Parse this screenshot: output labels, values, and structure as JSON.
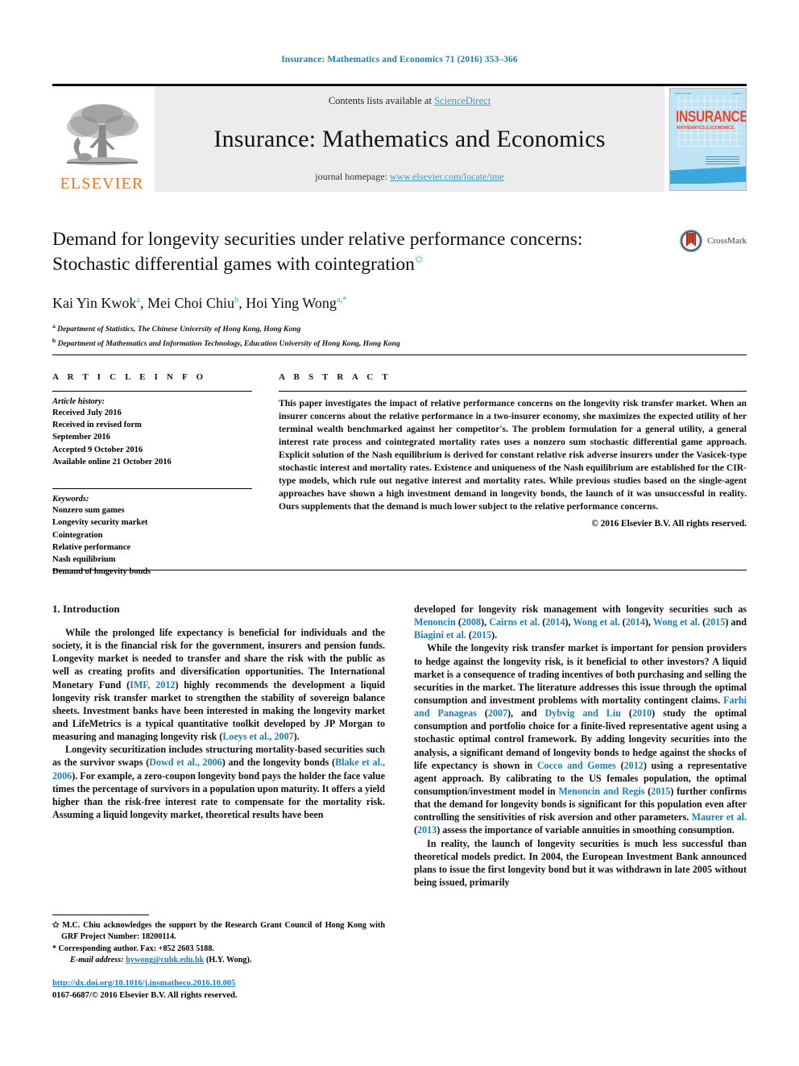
{
  "running_head": "Insurance: Mathematics and Economics 71 (2016) 353–366",
  "masthead": {
    "contents_prefix": "Contents lists available at ",
    "sciencedirect": "ScienceDirect",
    "journal_title": "Insurance: Mathematics and Economics",
    "homepage_prefix": "journal homepage: ",
    "homepage_url": "www.elsevier.com/locate/ime",
    "publisher": "ELSEVIER",
    "cover": {
      "title": "INSURANCE",
      "subtitle": "MATHEMATICS & ECONOMICS",
      "header_left": "ISSN 0167-6687",
      "header_right": "Volume 71"
    },
    "accent_blue": "#2f9fd0",
    "elsevier_orange": "#E87722"
  },
  "article": {
    "title": "Demand for longevity securities under relative performance concerns: Stochastic differential games with cointegration",
    "title_footnote_mark": "✩",
    "crossmark_label": "CrossMark",
    "authors": [
      {
        "name": "Kai Yin Kwok",
        "sup": "a"
      },
      {
        "name": "Mei Choi Chiu",
        "sup": "b"
      },
      {
        "name": "Hoi Ying Wong",
        "sup": "a,*"
      }
    ],
    "affiliations": [
      {
        "mark": "a",
        "text": "Department of Statistics, The Chinese University of Hong Kong, Hong Kong"
      },
      {
        "mark": "b",
        "text": "Department of Mathematics and Information Technology, Education University of Hong Kong, Hong Kong"
      }
    ]
  },
  "article_info": {
    "heading": "A R T I C L E   I N F O",
    "history_label": "Article history:",
    "history": [
      "Received July 2016",
      "Received in revised form",
      "September 2016",
      "Accepted 9 October 2016",
      "Available online 21 October 2016"
    ],
    "keywords_label": "Keywords:",
    "keywords": [
      "Nonzero sum games",
      "Longevity security market",
      "Cointegration",
      "Relative performance",
      "Nash equilibrium",
      "Demand of longevity bonds"
    ]
  },
  "abstract": {
    "heading": "A B S T R A C T",
    "text": "This paper investigates the impact of relative performance concerns on the longevity risk transfer market. When an insurer concerns about the relative performance in a two-insurer economy, she maximizes the expected utility of her terminal wealth benchmarked against her competitor's. The problem formulation for a general utility, a general interest rate process and cointegrated mortality rates uses a nonzero sum stochastic differential game approach. Explicit solution of the Nash equilibrium is derived for constant relative risk adverse insurers under the Vasicek-type stochastic interest and mortality rates. Existence and uniqueness of the Nash equilibrium are established for the CIR-type models, which rule out negative interest and mortality rates. While previous studies based on the single-agent approaches have shown a high investment demand in longevity bonds, the launch of it was unsuccessful in reality. Ours supplements that the demand is much lower subject to the relative performance concerns.",
    "copyright": "© 2016 Elsevier B.V. All rights reserved."
  },
  "body": {
    "section_title": "1. Introduction",
    "left_paragraphs": [
      {
        "segments": [
          {
            "t": "While the prolonged life expectancy is beneficial for individuals and the society, it is the financial risk for the government, insurers and pension funds. Longevity market is needed to transfer and share the risk with the public as well as creating profits and diversification opportunities. The International Monetary Fund ("
          },
          {
            "t": "IMF, 2012",
            "ref": true
          },
          {
            "t": ") highly recommends the development a liquid longevity risk transfer market to strengthen the stability of sovereign balance sheets. Investment banks have been interested in making the longevity market and LifeMetrics is a typical quantitative toolkit developed by JP Morgan to measuring and managing longevity risk ("
          },
          {
            "t": "Loeys et al., 2007",
            "ref": true
          },
          {
            "t": ")."
          }
        ]
      },
      {
        "segments": [
          {
            "t": "Longevity securitization includes structuring mortality-based securities such as the survivor swaps ("
          },
          {
            "t": "Dowd et al., 2006",
            "ref": true
          },
          {
            "t": ") and the longevity bonds ("
          },
          {
            "t": "Blake et al., 2006",
            "ref": true
          },
          {
            "t": "). For example, a zero-coupon longevity bond pays the holder the face value times the percentage of survivors in a population upon maturity. It offers a yield higher than the risk-free interest rate to compensate for the mortality risk. Assuming a liquid longevity market, theoretical results have been"
          }
        ]
      }
    ],
    "right_paragraphs": [
      {
        "indent": false,
        "segments": [
          {
            "t": "developed for longevity risk management with longevity securities such as "
          },
          {
            "t": "Menoncin",
            "ref": true
          },
          {
            "t": " ("
          },
          {
            "t": "2008",
            "ref": true
          },
          {
            "t": "), "
          },
          {
            "t": "Cairns et al.",
            "ref": true
          },
          {
            "t": " ("
          },
          {
            "t": "2014",
            "ref": true
          },
          {
            "t": "), "
          },
          {
            "t": "Wong et al.",
            "ref": true
          },
          {
            "t": " ("
          },
          {
            "t": "2014",
            "ref": true
          },
          {
            "t": "), "
          },
          {
            "t": "Wong et al.",
            "ref": true
          },
          {
            "t": " ("
          },
          {
            "t": "2015",
            "ref": true
          },
          {
            "t": ") and "
          },
          {
            "t": "Biagini et al.",
            "ref": true
          },
          {
            "t": " ("
          },
          {
            "t": "2015",
            "ref": true
          },
          {
            "t": ")."
          }
        ]
      },
      {
        "indent": true,
        "segments": [
          {
            "t": "While the longevity risk transfer market is important for pension providers to hedge against the longevity risk, is it beneficial to other investors? A liquid market is a consequence of trading incentives of both purchasing and selling the securities in the market. The literature addresses this issue through the optimal consumption and investment problems with mortality contingent claims. "
          },
          {
            "t": "Farhi and Panageas",
            "ref": true
          },
          {
            "t": " ("
          },
          {
            "t": "2007",
            "ref": true
          },
          {
            "t": "), and "
          },
          {
            "t": "Dybvig and Liu",
            "ref": true
          },
          {
            "t": " ("
          },
          {
            "t": "2010",
            "ref": true
          },
          {
            "t": ") study the optimal consumption and portfolio choice for a finite-lived representative agent using a stochastic optimal control framework. By adding longevity securities into the analysis, a significant demand of longevity bonds to hedge against the shocks of life expectancy is shown in "
          },
          {
            "t": "Cocco and Gomes",
            "ref": true
          },
          {
            "t": " ("
          },
          {
            "t": "2012",
            "ref": true
          },
          {
            "t": ") using a representative agent approach. By calibrating to the US females population, the optimal consumption/investment model in "
          },
          {
            "t": "Menoncin and Regis",
            "ref": true
          },
          {
            "t": " ("
          },
          {
            "t": "2015",
            "ref": true
          },
          {
            "t": ") further confirms that the demand for longevity bonds is significant for this population even after controlling the sensitivities of risk aversion and other parameters. "
          },
          {
            "t": "Maurer et al.",
            "ref": true
          },
          {
            "t": " ("
          },
          {
            "t": "2013",
            "ref": true
          },
          {
            "t": ") assess the importance of variable annuities in smoothing consumption."
          }
        ]
      },
      {
        "indent": true,
        "segments": [
          {
            "t": "In reality, the launch of longevity securities is much less successful than theoretical models predict. In 2004, the European Investment Bank announced plans to issue the first longevity bond but it was withdrawn in late 2005 without being issued, primarily"
          }
        ]
      }
    ]
  },
  "footnotes": {
    "funding_mark": "✩",
    "funding": "M.C. Chiu acknowledges the support by the Research Grant Council of Hong Kong with GRF Project Number: 18200114.",
    "corresponding_mark": "*",
    "corresponding": "Corresponding author. Fax: +852 2603 5188.",
    "email_label": "E-mail address:",
    "email": "hywong@cuhk.edu.hk",
    "email_attrib": "(H.Y. Wong).",
    "doi": "http://dx.doi.org/10.1016/j.insmatheco.2016.10.005",
    "issn_line": "0167-6687/© 2016 Elsevier B.V. All rights reserved."
  }
}
